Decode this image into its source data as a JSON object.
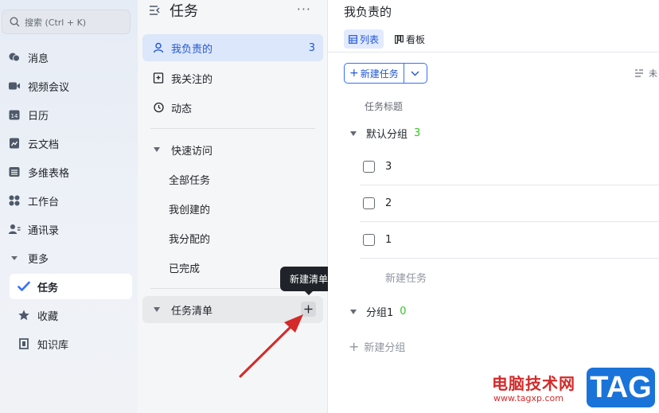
{
  "nav": {
    "search_placeholder": "搜索 (Ctrl + K)",
    "items": [
      {
        "label": "消息",
        "icon": "message-icon"
      },
      {
        "label": "视频会议",
        "icon": "video-icon"
      },
      {
        "label": "日历",
        "icon": "calendar-icon"
      },
      {
        "label": "云文档",
        "icon": "cloud-doc-icon"
      },
      {
        "label": "多维表格",
        "icon": "table-icon"
      },
      {
        "label": "工作台",
        "icon": "workplace-icon"
      },
      {
        "label": "通讯录",
        "icon": "contacts-icon"
      },
      {
        "label": "更多",
        "icon": "caret-down-icon"
      }
    ],
    "more_items": [
      {
        "label": "任务",
        "icon": "task-check-icon",
        "active": true
      },
      {
        "label": "收藏",
        "icon": "star-icon"
      },
      {
        "label": "知识库",
        "icon": "wiki-icon"
      }
    ],
    "calendar_day": "14"
  },
  "task_sidebar": {
    "title": "任务",
    "items": [
      {
        "label": "我负责的",
        "count": "3",
        "active": true
      },
      {
        "label": "我关注的"
      },
      {
        "label": "动态"
      }
    ],
    "quick_access": {
      "label": "快速访问",
      "items": [
        "全部任务",
        "我创建的",
        "我分配的",
        "已完成"
      ]
    },
    "task_list": {
      "label": "任务清单"
    },
    "tooltip": "新建清单"
  },
  "main": {
    "title": "我负责的",
    "tabs": [
      {
        "label": "列表",
        "active": true
      },
      {
        "label": "看板"
      }
    ],
    "new_task_button": "新建任务",
    "sort_label": "未",
    "column_header": "任务标题",
    "groups": [
      {
        "label": "默认分组",
        "count": "3",
        "tasks": [
          "3",
          "2",
          "1"
        ],
        "new_task": "新建任务"
      },
      {
        "label": "分组1",
        "count": "0"
      }
    ],
    "new_group": "新建分组"
  },
  "watermark": {
    "cn": "电脑技术网",
    "url": "www.tagxp.com",
    "tag": "TAG"
  },
  "colors": {
    "accent": "#3370ff",
    "active_bg": "#dde7fb",
    "count_green": "#34c724",
    "arrow": "#d42a2a"
  }
}
